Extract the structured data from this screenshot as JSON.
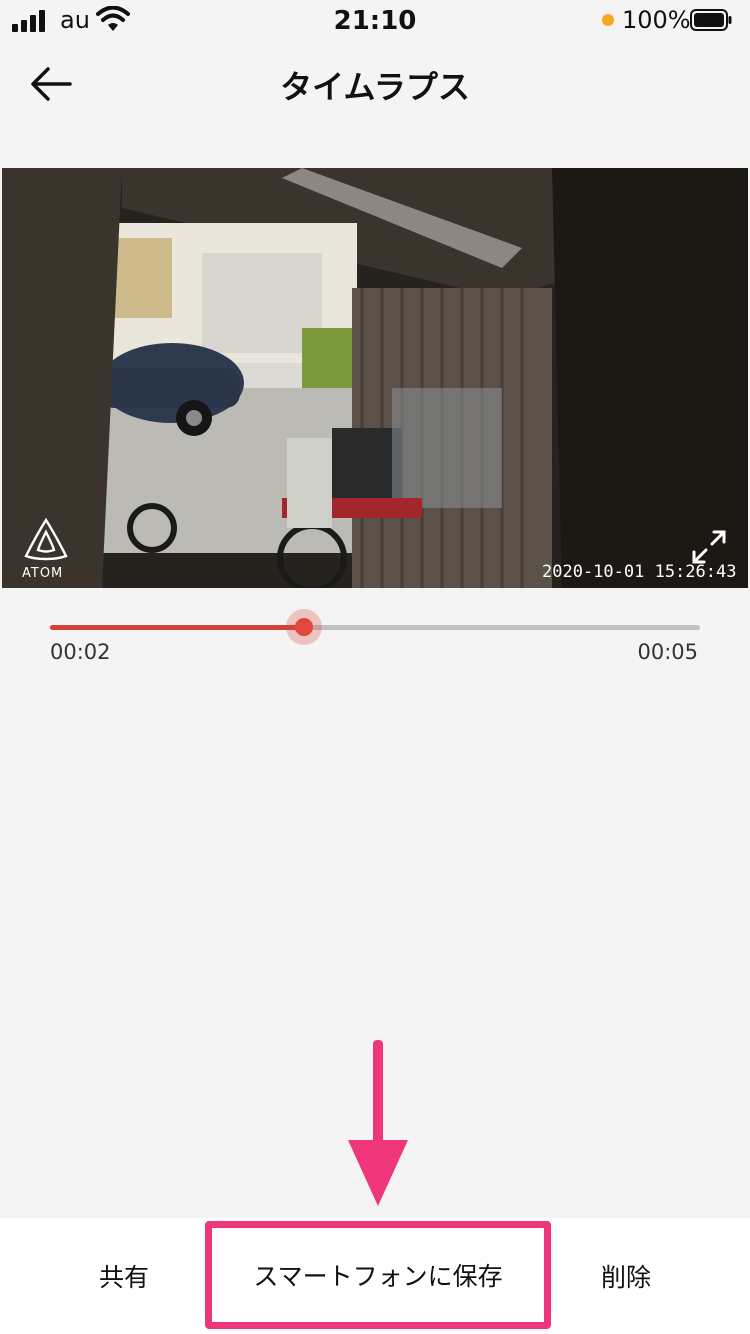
{
  "status_bar": {
    "carrier": "au",
    "time": "21:10",
    "battery": "100%",
    "dot_color": "#f5a623"
  },
  "nav": {
    "title": "タイムラプス",
    "back_icon": "back-arrow-icon"
  },
  "video": {
    "logo": "ATOM",
    "timestamp": "2020-10-01  15:26:43",
    "expand_icon": "expand-icon"
  },
  "player": {
    "current_time": "00:02",
    "total_time": "00:05",
    "progress": 0.39,
    "accent_color": "#d4433b"
  },
  "bottom_bar": {
    "share": "共有",
    "save": "スマートフォンに保存",
    "delete": "削除"
  },
  "annotation": {
    "highlight_color": "#f0367a"
  }
}
